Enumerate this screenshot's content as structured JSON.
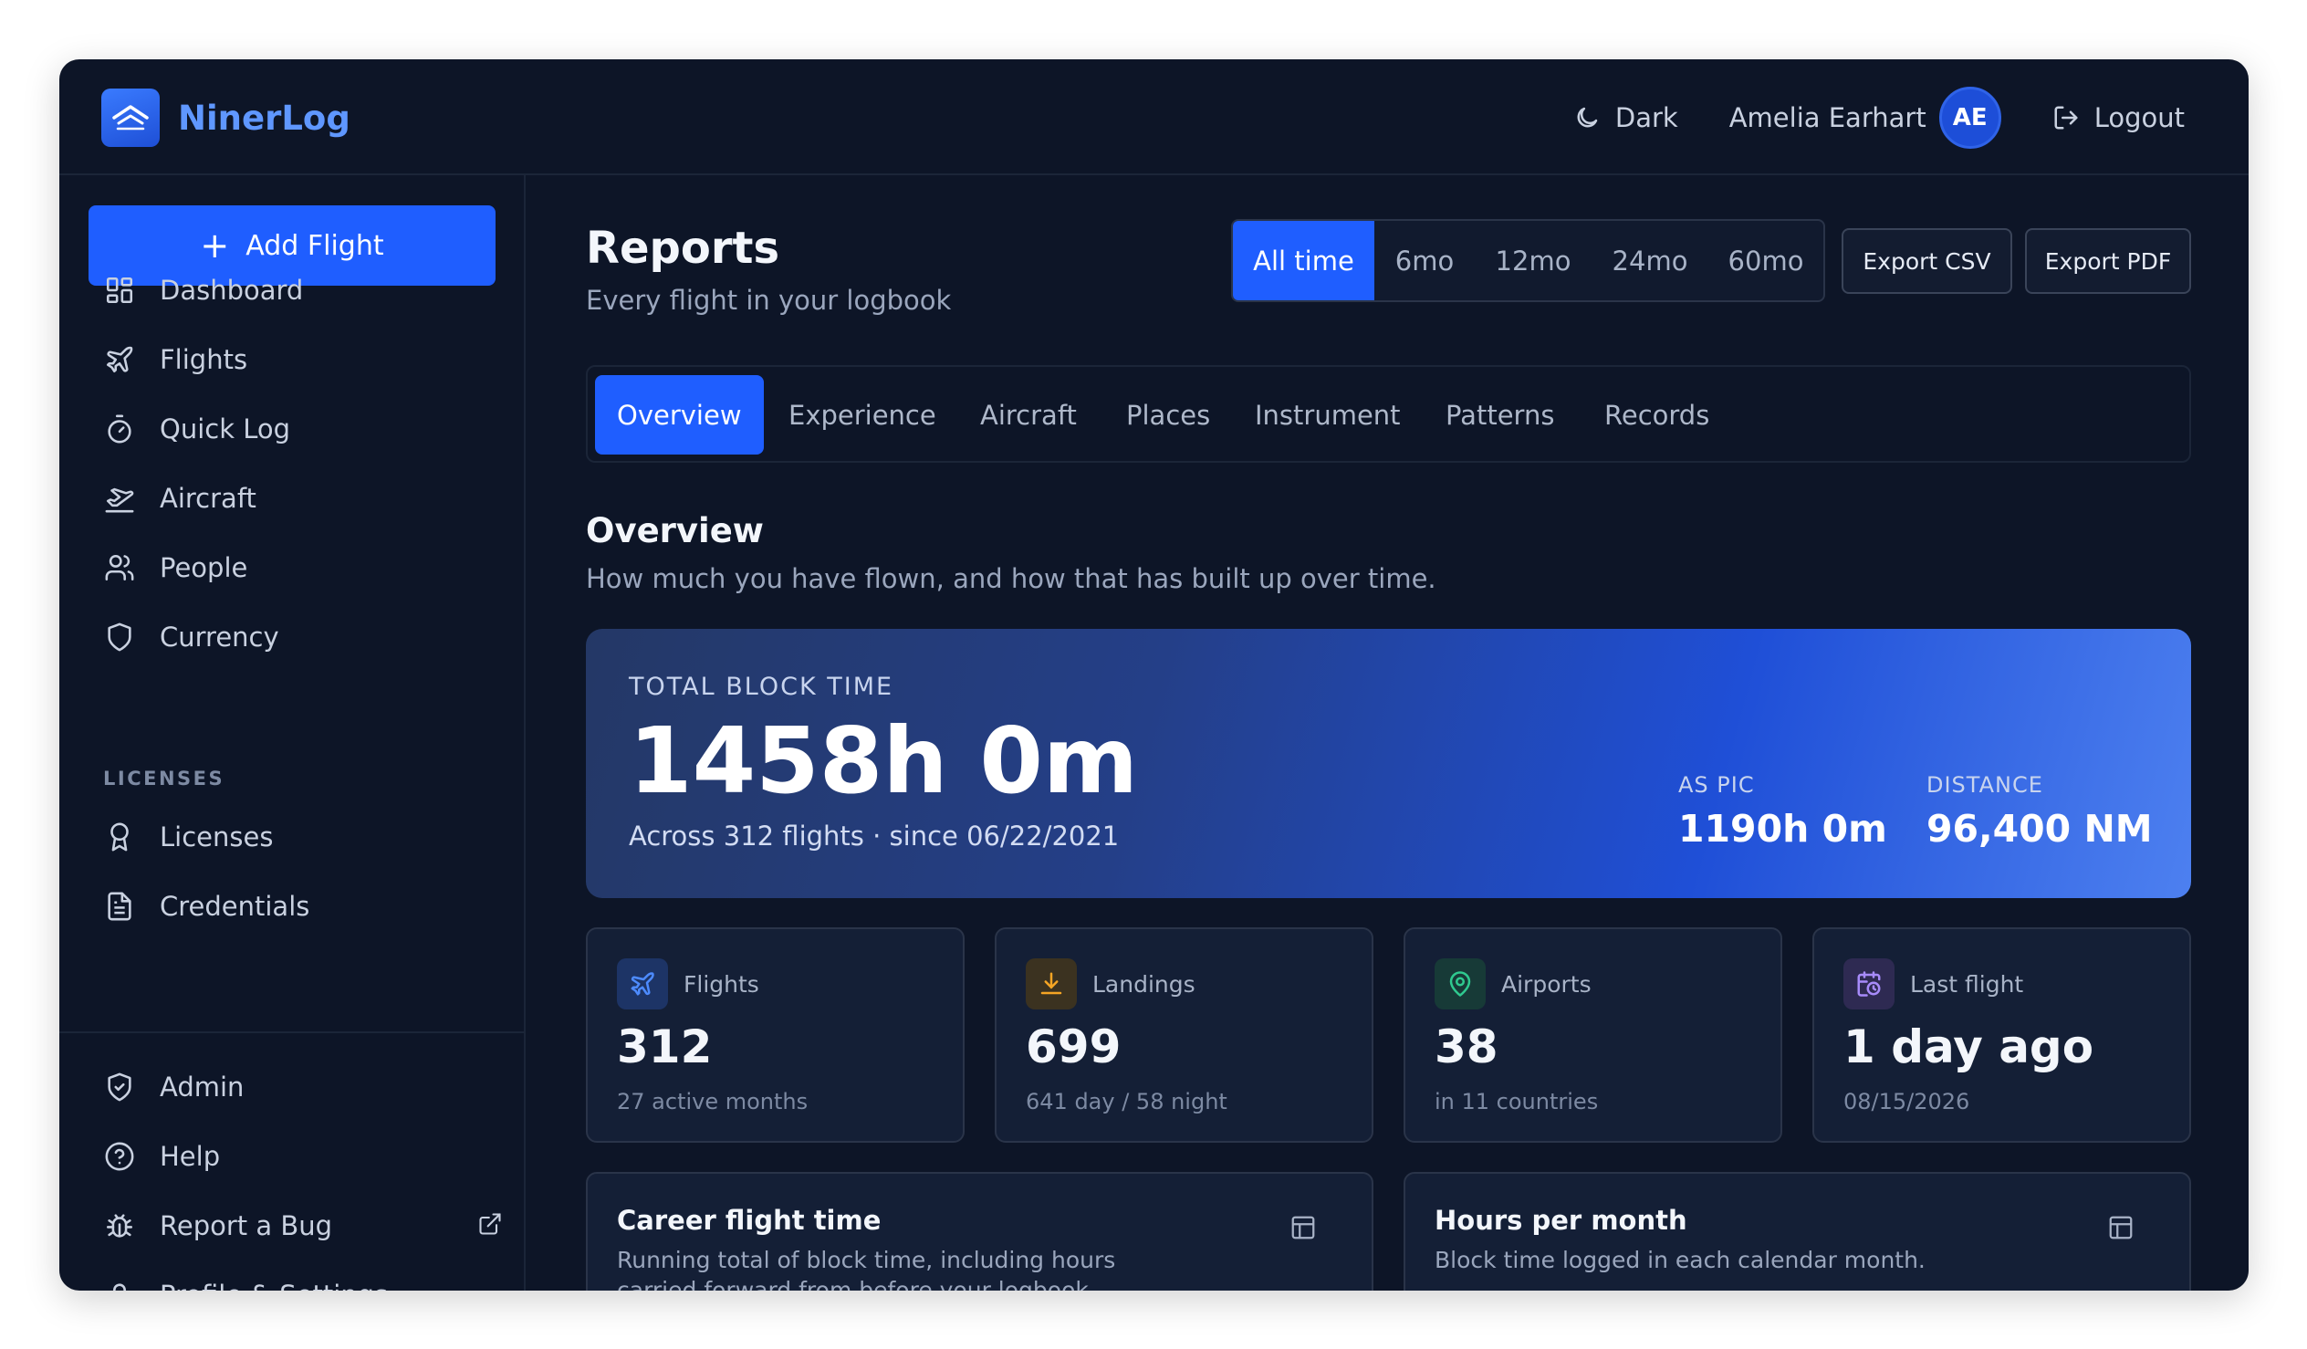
{
  "app": {
    "name": "NinerLog"
  },
  "header": {
    "theme_label": "Dark",
    "user_name": "Amelia Earhart",
    "avatar_initials": "AE",
    "logout_label": "Logout"
  },
  "sidebar": {
    "add_flight_label": "Add Flight",
    "items": [
      {
        "label": "Dashboard",
        "icon": "dashboard-icon"
      },
      {
        "label": "Flights",
        "icon": "plane-icon"
      },
      {
        "label": "Quick Log",
        "icon": "stopwatch-icon"
      },
      {
        "label": "Aircraft",
        "icon": "plane-takeoff-icon"
      },
      {
        "label": "People",
        "icon": "users-icon"
      },
      {
        "label": "Currency",
        "icon": "shield-icon"
      }
    ],
    "licenses_section": "LICENSES",
    "license_items": [
      {
        "label": "Licenses",
        "icon": "award-icon"
      },
      {
        "label": "Credentials",
        "icon": "document-icon"
      }
    ],
    "footer_items": [
      {
        "label": "Admin",
        "icon": "shield-check-icon"
      },
      {
        "label": "Help",
        "icon": "help-circle-icon"
      },
      {
        "label": "Report a Bug",
        "icon": "bug-icon"
      },
      {
        "label": "Profile & Settings",
        "icon": "user-icon"
      }
    ]
  },
  "page": {
    "title": "Reports",
    "subtitle": "Every flight in your logbook",
    "ranges": [
      "All time",
      "6mo",
      "12mo",
      "24mo",
      "60mo"
    ],
    "active_range": "All time",
    "export_csv": "Export CSV",
    "export_pdf": "Export PDF",
    "tabs": [
      "Overview",
      "Experience",
      "Aircraft",
      "Places",
      "Instrument",
      "Patterns",
      "Records"
    ],
    "active_tab": "Overview"
  },
  "overview": {
    "title": "Overview",
    "subtitle": "How much you have flown, and how that has built up over time.",
    "hero": {
      "label": "TOTAL BLOCK TIME",
      "value": "1458h 0m",
      "sub": "Across 312 flights · since 06/22/2021",
      "pic_label": "AS PIC",
      "pic_value": "1190h 0m",
      "distance_label": "DISTANCE",
      "distance_value": "96,400 NM"
    },
    "stats": [
      {
        "label": "Flights",
        "value": "312",
        "sub": "27 active months",
        "icon": "plane-icon",
        "color": "#4d8bff"
      },
      {
        "label": "Landings",
        "value": "699",
        "sub": "641 day / 58 night",
        "icon": "download-icon",
        "color": "#f5a524"
      },
      {
        "label": "Airports",
        "value": "38",
        "sub": "in 11 countries",
        "icon": "map-pin-icon",
        "color": "#2fc98f"
      },
      {
        "label": "Last flight",
        "value": "1 day ago",
        "sub": "08/15/2026",
        "icon": "calendar-clock-icon",
        "color": "#a78bfa"
      }
    ],
    "charts": [
      {
        "title": "Career flight time",
        "desc": "Running total of block time, including hours carried forward from before your logbook."
      },
      {
        "title": "Hours per month",
        "desc": "Block time logged in each calendar month."
      }
    ]
  }
}
